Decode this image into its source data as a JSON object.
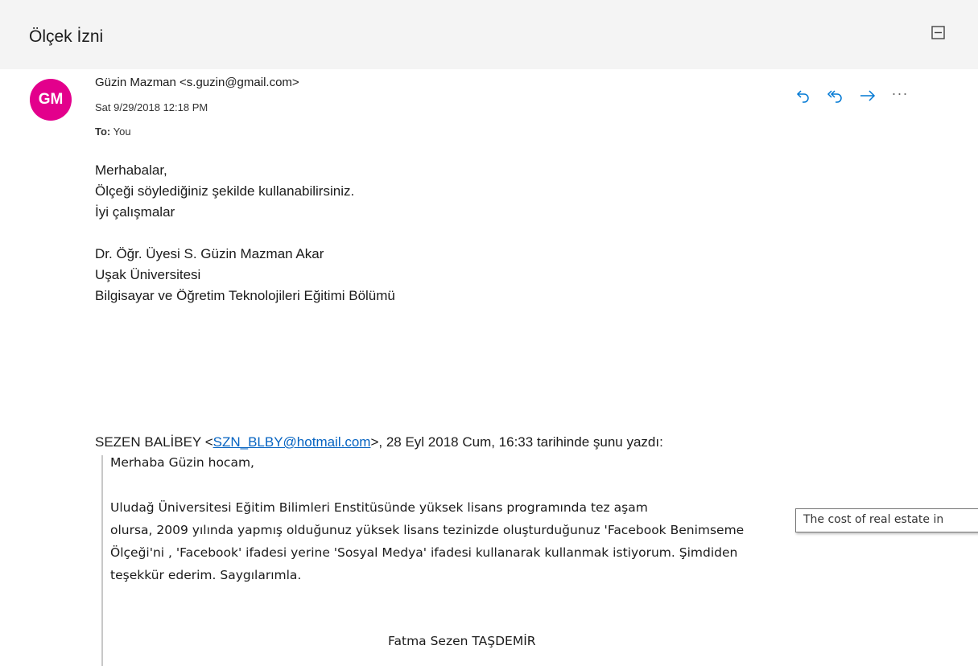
{
  "message": {
    "subject": "Ölçek İzni",
    "avatar_initials": "GM",
    "avatar_color": "#e3008c",
    "sender": "Güzin Mazman <s.guzin@gmail.com>",
    "date": "Sat 9/29/2018 12:18 PM",
    "to_label": "To:",
    "to_value": "You",
    "body": [
      "Merhabalar,",
      "Ölçeği söylediğiniz şekilde kullanabilirsiniz.",
      "İyi çalışmalar",
      "",
      "Dr. Öğr. Üyesi S. Güzin Mazman Akar",
      "Uşak Üniversitesi",
      "Bilgisayar ve Öğretim Teknolojileri Eğitimi Bölümü"
    ]
  },
  "icons": {
    "collapse": "collapse-icon",
    "reply": "reply-icon",
    "reply_all": "reply-all-icon",
    "forward": "forward-icon",
    "more": "more-icon"
  },
  "quote": {
    "prefix": "SEZEN BALİBEY <",
    "email": "SZN_BLBY@hotmail.com",
    "suffix": ">, 28 Eyl 2018 Cum, 16:33 tarihinde şunu yazdı:",
    "greeting": "Merhaba Güzin hocam,",
    "para_line1": "Uludağ Üniversitesi Eğitim Bilimleri Enstitüsünde yüksek lisans programında tez aşam",
    "para_line2": "olursa, 2009 yılında yapmış olduğunuz yüksek lisans tezinizde oluşturduğunuz 'Facebook Benimseme",
    "para_line3": "Ölçeği'ni , 'Facebook' ifadesi yerine 'Sosyal Medya' ifadesi kullanarak kullanmak istiyorum.  Şimdiden",
    "para_line4": "teşekkür ederim. Saygılarımla.",
    "signature": "Fatma Sezen TAŞDEMİR"
  },
  "tooltip": "The cost of real estate in",
  "colors": {
    "accent": "#0078d4",
    "link": "#0563c1",
    "header_bg": "#f4f4f4"
  }
}
